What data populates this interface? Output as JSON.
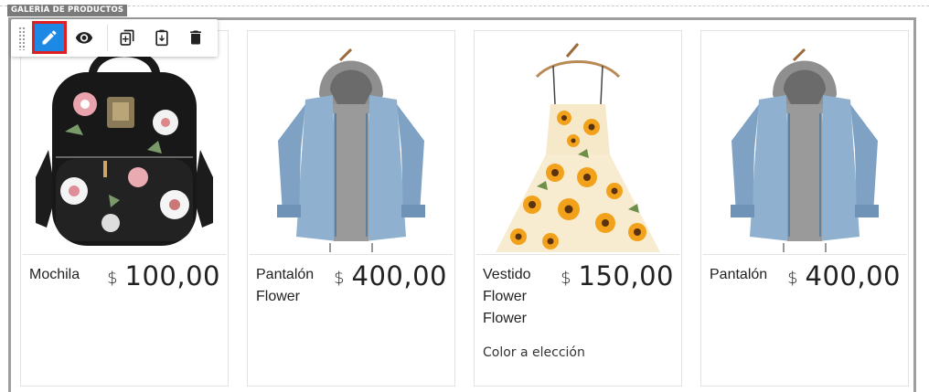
{
  "section": {
    "label": "GALERÍA DE PRODUCTOS"
  },
  "toolbar": {
    "buttons": [
      {
        "icon": "pencil-icon",
        "action": "edit",
        "active": true
      },
      {
        "icon": "eye-icon",
        "action": "preview"
      },
      {
        "icon": "duplicate-icon",
        "action": "duplicate"
      },
      {
        "icon": "clipboard-icon",
        "action": "paste"
      },
      {
        "icon": "trash-icon",
        "action": "delete"
      }
    ],
    "active_color": "#1e88e5",
    "highlight_color": "#e02020"
  },
  "products": [
    {
      "name": "Mochila",
      "currency": "$",
      "price": "100,00",
      "description": "",
      "image": "backpack"
    },
    {
      "name": "Pantalón Flower",
      "currency": "$",
      "price": "400,00",
      "description": "",
      "image": "denim-jacket"
    },
    {
      "name": "Vestido Flower Flower",
      "currency": "$",
      "price": "150,00",
      "description": "Color a elección",
      "image": "sunflower-dress"
    },
    {
      "name": "Pantalón",
      "currency": "$",
      "price": "400,00",
      "description": "",
      "image": "denim-jacket"
    }
  ]
}
